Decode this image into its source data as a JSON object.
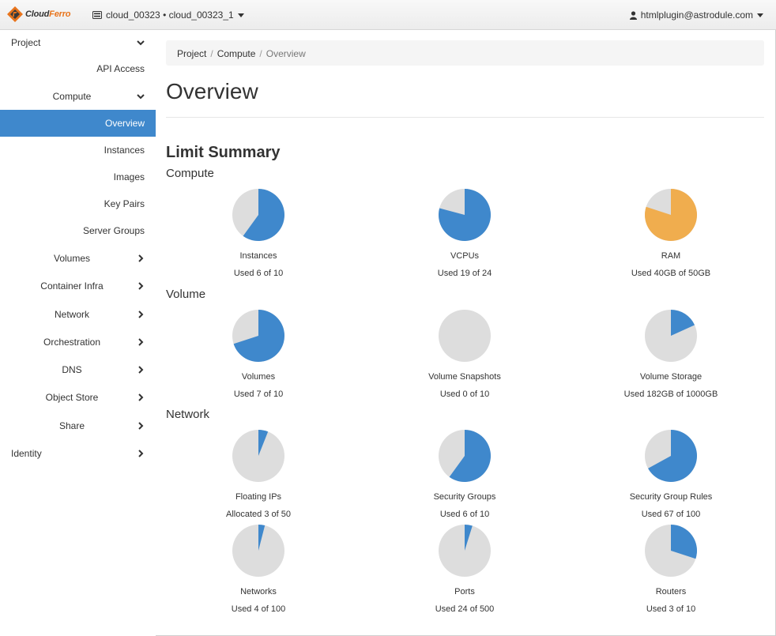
{
  "header": {
    "brand_part1": "Cloud",
    "brand_part2": "Ferro",
    "project_label": "cloud_00323 • cloud_00323_1",
    "user_label": "htmlplugin@astrodule.com"
  },
  "sidebar": {
    "items": [
      {
        "label": "Project",
        "level": 0,
        "chevron": "down"
      },
      {
        "label": "API Access",
        "level": 2,
        "chevron": ""
      },
      {
        "label": "Compute",
        "level": 1,
        "chevron": "down"
      },
      {
        "label": "Overview",
        "level": 2,
        "chevron": "",
        "active": true
      },
      {
        "label": "Instances",
        "level": 2,
        "chevron": ""
      },
      {
        "label": "Images",
        "level": 2,
        "chevron": ""
      },
      {
        "label": "Key Pairs",
        "level": 2,
        "chevron": ""
      },
      {
        "label": "Server Groups",
        "level": 2,
        "chevron": ""
      },
      {
        "label": "Volumes",
        "level": 1,
        "chevron": "right"
      },
      {
        "label": "Container Infra",
        "level": 1,
        "chevron": "right"
      },
      {
        "label": "Network",
        "level": 1,
        "chevron": "right"
      },
      {
        "label": "Orchestration",
        "level": 1,
        "chevron": "right"
      },
      {
        "label": "DNS",
        "level": 1,
        "chevron": "right"
      },
      {
        "label": "Object Store",
        "level": 1,
        "chevron": "right"
      },
      {
        "label": "Share",
        "level": 1,
        "chevron": "right"
      },
      {
        "label": "Identity",
        "level": 0,
        "chevron": "right"
      }
    ]
  },
  "breadcrumb": {
    "items": [
      "Project",
      "Compute"
    ],
    "current": "Overview"
  },
  "page": {
    "title": "Overview",
    "limit_summary_title": "Limit Summary"
  },
  "colors": {
    "used_blue": "#3f88cc",
    "warn_orange": "#f0ad4e",
    "free_gray": "#dddddd",
    "active_nav": "#3f88cc"
  },
  "sections": [
    {
      "title": "Compute",
      "charts": [
        {
          "label": "Instances",
          "usage": "Used 6 of 10",
          "used": 6,
          "total": 10,
          "color": "#3f88cc"
        },
        {
          "label": "VCPUs",
          "usage": "Used 19 of 24",
          "used": 19,
          "total": 24,
          "color": "#3f88cc"
        },
        {
          "label": "RAM",
          "usage": "Used 40GB of 50GB",
          "used": 40,
          "total": 50,
          "color": "#f0ad4e"
        }
      ]
    },
    {
      "title": "Volume",
      "charts": [
        {
          "label": "Volumes",
          "usage": "Used 7 of 10",
          "used": 7,
          "total": 10,
          "color": "#3f88cc"
        },
        {
          "label": "Volume Snapshots",
          "usage": "Used 0 of 10",
          "used": 0,
          "total": 10,
          "color": "#3f88cc"
        },
        {
          "label": "Volume Storage",
          "usage": "Used 182GB of 1000GB",
          "used": 182,
          "total": 1000,
          "color": "#3f88cc"
        }
      ]
    },
    {
      "title": "Network",
      "charts": [
        {
          "label": "Floating IPs",
          "usage": "Allocated 3 of 50",
          "used": 3,
          "total": 50,
          "color": "#3f88cc"
        },
        {
          "label": "Security Groups",
          "usage": "Used 6 of 10",
          "used": 6,
          "total": 10,
          "color": "#3f88cc"
        },
        {
          "label": "Security Group Rules",
          "usage": "Used 67 of 100",
          "used": 67,
          "total": 100,
          "color": "#3f88cc"
        },
        {
          "label": "Networks",
          "usage": "Used 4 of 100",
          "used": 4,
          "total": 100,
          "color": "#3f88cc"
        },
        {
          "label": "Ports",
          "usage": "Used 24 of 500",
          "used": 24,
          "total": 500,
          "color": "#3f88cc"
        },
        {
          "label": "Routers",
          "usage": "Used 3 of 10",
          "used": 3,
          "total": 10,
          "color": "#3f88cc"
        }
      ]
    }
  ]
}
